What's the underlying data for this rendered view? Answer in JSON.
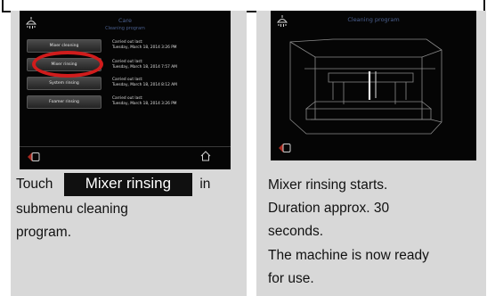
{
  "left_screen": {
    "title": "Care",
    "subtitle": "Cleaning program",
    "menu_buttons": [
      {
        "label": "Mixer cleaning"
      },
      {
        "label": "Mixer rinsing"
      },
      {
        "label": "System rinsing"
      },
      {
        "label": "Foamer rinsing"
      }
    ],
    "carried_out": [
      {
        "label": "Carried out last:",
        "date": "Tuesday, March 18, 2014 3:26 PM"
      },
      {
        "label": "Carried out last:",
        "date": "Tuesday, March 18, 2014 7:57 AM"
      },
      {
        "label": "Carried out last:",
        "date": "Tuesday, March 18, 2014 8:12 AM"
      },
      {
        "label": "Carried out last:",
        "date": "Tuesday, March 18, 2014 3:26 PM"
      }
    ]
  },
  "right_screen": {
    "title": "Cleaning program"
  },
  "left_caption": {
    "before": "Touch",
    "button": "Mixer rinsing",
    "after_inline": "in",
    "line2": "submenu cleaning",
    "line3": "program."
  },
  "right_caption": {
    "line1": "Mixer rinsing starts.",
    "line2": "Duration approx. 30",
    "line3": "seconds.",
    "line4": "The machine is now ready",
    "line5": "for use."
  },
  "colors": {
    "panel_bg": "#d8d8d8",
    "screen_bg": "#050505",
    "screen_title": "#4a5f8e",
    "highlight_ring": "#d01c1c"
  }
}
